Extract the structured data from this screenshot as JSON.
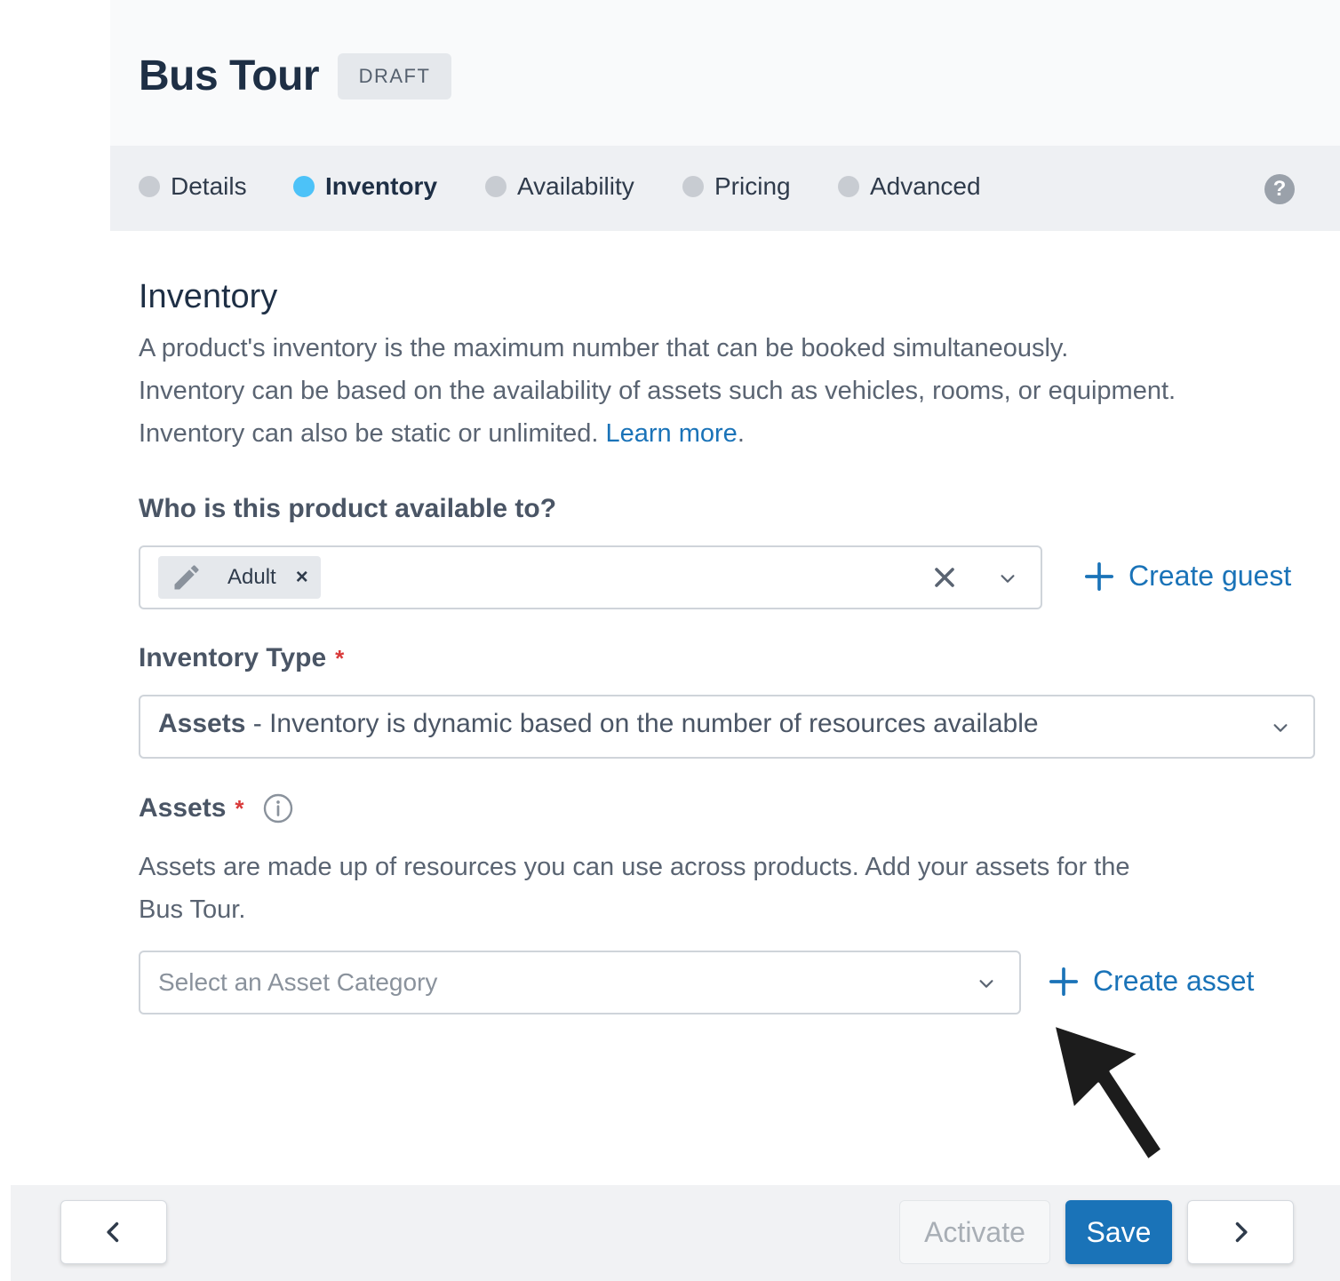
{
  "header": {
    "title": "Bus Tour",
    "status_badge": "DRAFT"
  },
  "steps": [
    {
      "label": "Details",
      "active": false
    },
    {
      "label": "Inventory",
      "active": true
    },
    {
      "label": "Availability",
      "active": false
    },
    {
      "label": "Pricing",
      "active": false
    },
    {
      "label": "Advanced",
      "active": false
    }
  ],
  "help_label": "?",
  "section": {
    "title": "Inventory",
    "description_line1": "A product's inventory is the maximum number that can be booked simultaneously.",
    "description_line2": "Inventory can be based on the availability of assets such as vehicles, rooms, or equipment.",
    "description_line3": "Inventory can also be static or unlimited.",
    "learn_more": "Learn more",
    "period": "."
  },
  "availability": {
    "label": "Who is this product available to?",
    "selected_chip": "Adult",
    "chip_remove": "×",
    "create_label": "Create guest"
  },
  "inventory_type": {
    "label": "Inventory Type",
    "required_mark": "*",
    "selected_bold": "Assets",
    "selected_rest": " - Inventory is dynamic based on the number of resources available"
  },
  "assets": {
    "label": "Assets",
    "required_mark": "*",
    "description_line1": "Assets are made up of resources you can use across products. Add your assets for the",
    "description_line2": "Bus Tour.",
    "select_placeholder": "Select an Asset Category",
    "create_label": "Create asset"
  },
  "footer": {
    "back_label": "‹",
    "activate_label": "Activate",
    "save_label": "Save",
    "next_label": "›"
  },
  "colors": {
    "accent": "#1a73b8",
    "active_step": "#4cc2f8",
    "required": "#d93a3a"
  }
}
